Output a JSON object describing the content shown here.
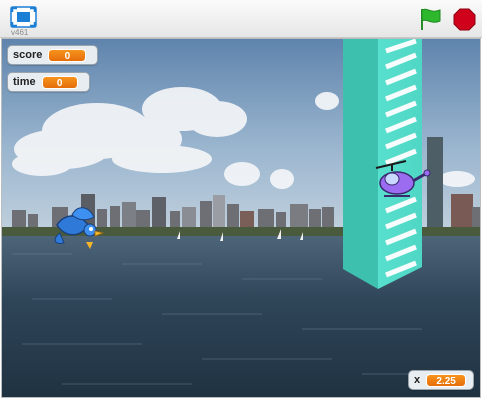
{
  "player": {
    "version": "v461",
    "fullscreen_icon": "fullscreen-icon",
    "green_flag_icon": "green-flag-icon",
    "stop_icon": "stop-sign-icon",
    "accent_colors": {
      "flag": "#2eb82e",
      "stop": "#d0021b",
      "monitor_value": "#f7941d"
    }
  },
  "monitors": {
    "score": {
      "label": "score",
      "value": "0"
    },
    "time": {
      "label": "time",
      "value": "0"
    },
    "x": {
      "label": "x",
      "value": "2.25"
    }
  },
  "stage": {
    "sprites": [
      "bird",
      "helicopter",
      "tower"
    ],
    "backdrop": "city-skyline-over-water"
  }
}
